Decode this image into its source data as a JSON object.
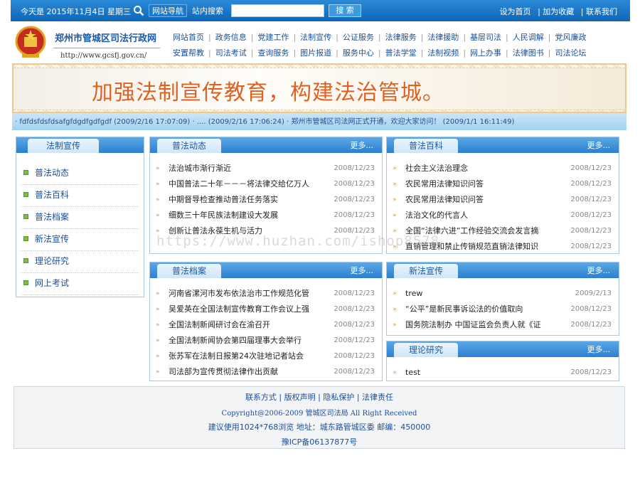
{
  "topbar": {
    "date": "今天是 2015年11月4日 星期三",
    "btn_nav": "网站导航",
    "btn_search_site": "站内搜索",
    "search_placeholder": "",
    "search_btn": "搜 索",
    "links": [
      "设为首页",
      "加为收藏",
      "联系我们"
    ]
  },
  "header": {
    "site_name": "郑州市管城区司法行政网",
    "site_url": "http://www.gcsfj.gov.cn/",
    "nav_row1": [
      "网站首页",
      "政务信息",
      "党建工作",
      "法制宣传",
      "公证服务",
      "法律服务",
      "法律援助",
      "基层司法",
      "人民调解",
      "党风廉政"
    ],
    "nav_row2": [
      "安置帮教",
      "司法考试",
      "查询服务",
      "图片报道",
      "服务中心",
      "普法学堂",
      "法制视频",
      "网上办事",
      "法律图书",
      "司法论坛"
    ]
  },
  "banner": {
    "slogan": "加强法制宣传教育，构建法治管城。"
  },
  "ticker": {
    "text": "· fdfdsfdsfdsafgfdgdfgdfgdf (2009/2/16 17:07:09)  · .... (2009/2/16 17:06:24)  · 郑州市管城区司法网正式开通，欢迎大家访问！ (2009/1/1 16:11:49)"
  },
  "sidebar": {
    "title": "法制宣传",
    "items": [
      "普法动态",
      "普法百科",
      "普法档案",
      "新法宣传",
      "理论研究",
      "网上考试"
    ]
  },
  "more_label": "更多...",
  "arrow": "»",
  "panels": {
    "pufa_dongtai": {
      "title": "普法动态",
      "items": [
        {
          "t": "法治城市渐行渐近",
          "d": "2008/12/23"
        },
        {
          "t": "中国普法二十年－－－将法律交给亿万人",
          "d": "2008/12/23"
        },
        {
          "t": "中期督导检查推动普法任务落实",
          "d": "2008/12/23"
        },
        {
          "t": "细数三十年民族法制建设大发展",
          "d": "2008/12/23"
        },
        {
          "t": "创新让普法永葆生机与活力",
          "d": "2008/12/23"
        }
      ]
    },
    "pufa_baike": {
      "title": "普法百科",
      "items": [
        {
          "t": "社会主义法治理念",
          "d": "2008/12/23"
        },
        {
          "t": "农民常用法律知识问答",
          "d": "2008/12/23"
        },
        {
          "t": "农民常用法律知识问答",
          "d": "2008/12/23"
        },
        {
          "t": "法治文化的代言人",
          "d": "2008/12/23"
        },
        {
          "t": "全国“法律六进”工作经验交流会发言摘",
          "d": "2008/12/23"
        },
        {
          "t": "直销管理和禁止传销规范直销法律知识",
          "d": "2008/12/23"
        }
      ]
    },
    "pufa_dangan": {
      "title": "普法档案",
      "items": [
        {
          "t": "河南省漯河市发布依法治市工作规范化管",
          "d": "2008/12/23"
        },
        {
          "t": "吴爱英在全国法制宣传教育工作会议上强",
          "d": "2008/12/23"
        },
        {
          "t": "全国法制新闻研讨会在渝召开",
          "d": "2008/12/23"
        },
        {
          "t": "全国法制新闻协会第四届理事大会举行",
          "d": "2008/12/23"
        },
        {
          "t": "张苏军在法制日报第24次驻地记者站会",
          "d": "2008/12/23"
        },
        {
          "t": "司法部为宣传贯彻法律作出贡献",
          "d": "2008/12/23"
        }
      ]
    },
    "xinfa_xuanchuan": {
      "title": "新法宣传",
      "items": [
        {
          "t": "trew",
          "d": "2009/2/13"
        },
        {
          "t": "“公平”是新民事诉讼法的价值取向",
          "d": "2008/12/23"
        },
        {
          "t": "国务院法制办 中国证监会负责人就《证",
          "d": "2008/12/23"
        }
      ]
    },
    "lilun_yanjiu": {
      "title": "理论研究",
      "items": [
        {
          "t": "test",
          "d": "2008/12/23"
        }
      ]
    }
  },
  "footer": {
    "links": [
      "联系方式",
      "版权声明",
      "隐私保护",
      "法律责任"
    ],
    "copyright": "Copyright@2006-2009  管城区司法局  All Right Received",
    "address": "建议使用1024*768浏览   地址：城东路管城区委   邮编：450000",
    "icp": "豫ICP备06137877号"
  },
  "watermark": "https://www.huzhan.com/ishop8578"
}
